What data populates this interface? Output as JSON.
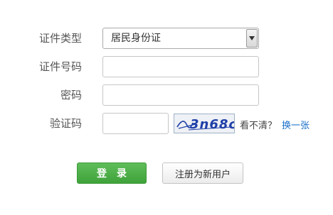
{
  "form": {
    "id_type": {
      "label": "证件类型",
      "selected": "居民身份证"
    },
    "id_number": {
      "label": "证件号码",
      "value": ""
    },
    "password": {
      "label": "密码",
      "value": ""
    },
    "captcha": {
      "label": "验证码",
      "value": "",
      "image_text": "3n68c",
      "unclear_text": "看不清？",
      "refresh_link": "换一张"
    },
    "login_button": "登录",
    "register_button": "注册为新用户"
  },
  "colors": {
    "login_green": "#4caf45",
    "link_blue": "#1a6fc9"
  },
  "icons": {
    "select_arrow": "chevron-down-icon"
  }
}
